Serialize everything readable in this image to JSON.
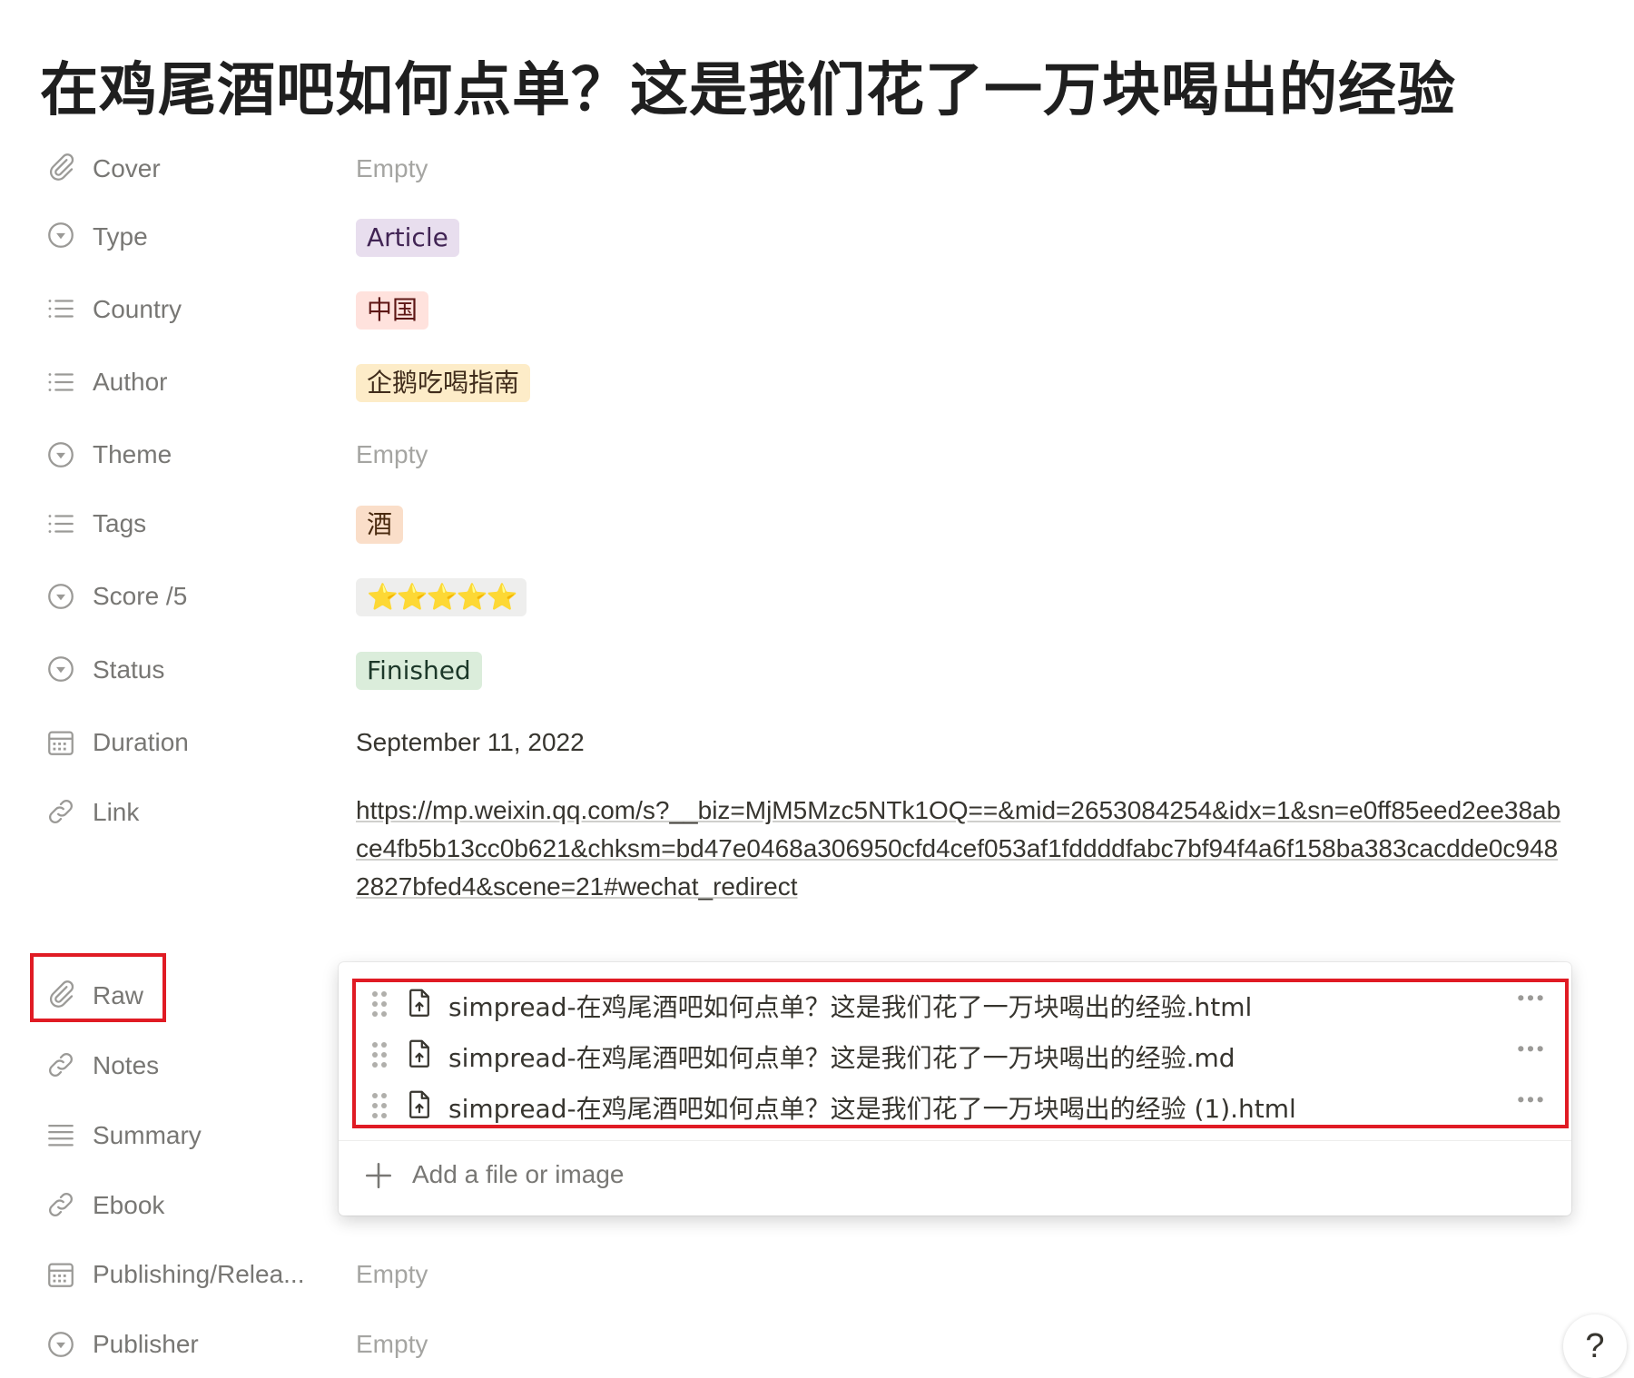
{
  "page": {
    "title": "在鸡尾酒吧如何点单？这是我们花了一万块喝出的经验"
  },
  "properties": {
    "cover": {
      "label": "Cover",
      "value": "Empty",
      "icon": "paperclip-icon"
    },
    "type": {
      "label": "Type",
      "value": "Article",
      "icon": "select-icon",
      "color": "#e8deee",
      "text_color": "#412454"
    },
    "country": {
      "label": "Country",
      "value": "中国",
      "icon": "list-icon",
      "color": "#ffe2dd",
      "text_color": "#5d1715"
    },
    "author": {
      "label": "Author",
      "value": "企鹅吃喝指南",
      "icon": "list-icon",
      "color": "#fdecc8",
      "text_color": "#402c1b"
    },
    "theme": {
      "label": "Theme",
      "value": "Empty",
      "icon": "select-icon"
    },
    "tags": {
      "label": "Tags",
      "value": "酒",
      "icon": "list-icon",
      "color": "#fadec9",
      "text_color": "#49290e"
    },
    "score": {
      "label": "Score /5",
      "value": "⭐⭐⭐⭐⭐",
      "icon": "select-icon",
      "color": "#eeeeed"
    },
    "status": {
      "label": "Status",
      "value": "Finished",
      "icon": "select-icon",
      "color": "#dbeddb",
      "text_color": "#1c3829"
    },
    "duration": {
      "label": "Duration",
      "value": "September 11, 2022",
      "icon": "calendar-icon"
    },
    "link": {
      "label": "Link",
      "value": "https://mp.weixin.qq.com/s?__biz=MjM5Mzc5NTk1OQ==&mid=2653084254&idx=1&sn=e0ff85eed2ee38abce4fb5b13cc0b621&chksm=bd47e0468a306950cfd4cef053af1fddddfabc7bf94f4a6f158ba383cacdde0c9482827bfed4&scene=21#wechat_redirect",
      "icon": "link-icon"
    },
    "raw": {
      "label": "Raw",
      "icon": "paperclip-icon"
    },
    "notes": {
      "label": "Notes",
      "icon": "link-icon"
    },
    "summary": {
      "label": "Summary",
      "icon": "text-icon"
    },
    "ebook": {
      "label": "Ebook",
      "icon": "link-icon"
    },
    "publishing": {
      "label": "Publishing/Relea...",
      "value": "Empty",
      "icon": "calendar-icon"
    },
    "publisher": {
      "label": "Publisher",
      "value": "Empty",
      "icon": "select-icon"
    }
  },
  "files_popup": {
    "files": [
      {
        "name": "simpread-在鸡尾酒吧如何点单？这是我们花了一万块喝出的经验.html"
      },
      {
        "name": "simpread-在鸡尾酒吧如何点单？这是我们花了一万块喝出的经验.md"
      },
      {
        "name": "simpread-在鸡尾酒吧如何点单？这是我们花了一万块喝出的经验 (1).html"
      }
    ],
    "add_label": "Add a file or image"
  },
  "help": {
    "label": "?"
  },
  "colors": {
    "highlight": "#e01b24"
  }
}
